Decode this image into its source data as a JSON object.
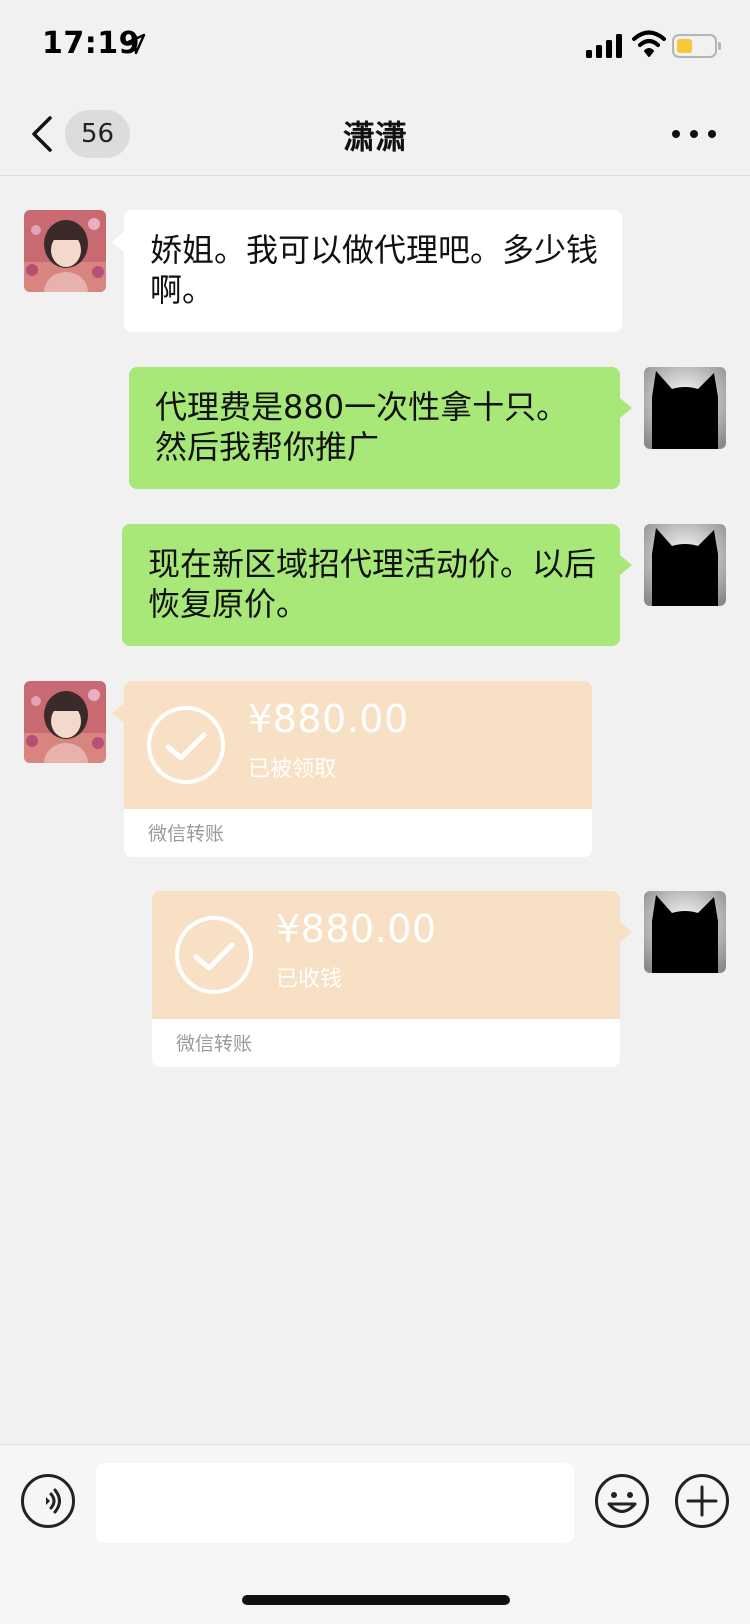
{
  "status_bar": {
    "time": "17:19"
  },
  "nav": {
    "unread_count": "56",
    "title": "潇潇"
  },
  "messages": [
    {
      "side": "left",
      "type": "text",
      "text": "娇姐。我可以做代理吧。多少钱啊。"
    },
    {
      "side": "right",
      "type": "text",
      "text": "代理费是880一次性拿十只。然后我帮你推广"
    },
    {
      "side": "right",
      "type": "text",
      "text": "现在新区域招代理活动价。以后恢复原价。"
    },
    {
      "side": "left",
      "type": "transfer",
      "amount": "¥880.00",
      "status": "已被领取",
      "label": "微信转账"
    },
    {
      "side": "right",
      "type": "transfer",
      "amount": "¥880.00",
      "status": "已收钱",
      "label": "微信转账"
    }
  ],
  "colors": {
    "background": "#f1f1f1",
    "sent_bubble": "#a8e879",
    "received_bubble": "#ffffff",
    "transfer_card": "#f7e0c4"
  },
  "icons": {
    "status": [
      "location-arrow-icon",
      "signal-icon",
      "wifi-icon",
      "battery-icon"
    ],
    "nav": [
      "chevron-left-icon",
      "more-dots-icon"
    ],
    "input_bar": [
      "voice-icon",
      "emoji-icon",
      "plus-icon"
    ]
  }
}
